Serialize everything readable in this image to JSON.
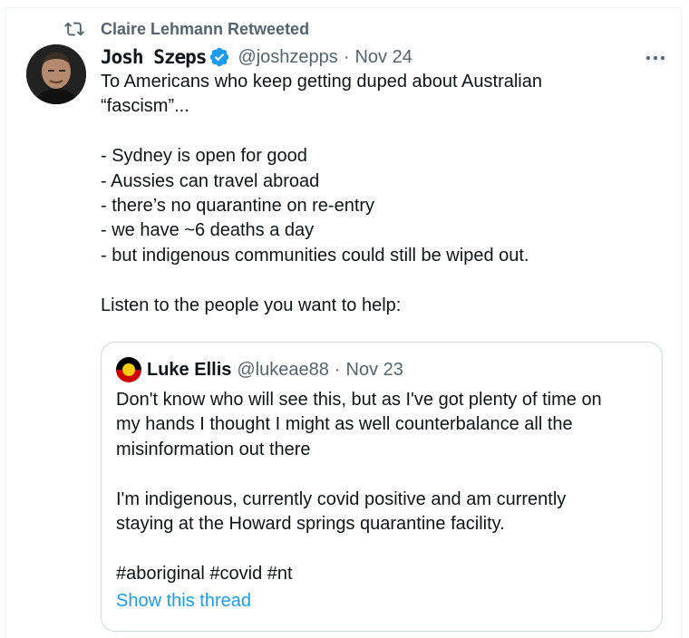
{
  "retweet": {
    "label": "Claire Lehmann Retweeted",
    "icon": "retweet-icon"
  },
  "author": {
    "display_name": "Josh Szeps",
    "handle": "@joshzepps",
    "separator": "·",
    "date": "Nov 24",
    "verified_icon": "verified-badge-icon",
    "verified_color": "#1d9bf0"
  },
  "more_icon": "more-options-icon",
  "tweet_text": "To Americans who keep getting duped about Australian\n“fascism”...\n\n- Sydney is open for good\n- Aussies can travel abroad\n- there’s no quarantine on re-entry\n- we have ~6 deaths a day\n- but indigenous communities could still be wiped out.\n\nListen to the people you want to help:",
  "quoted": {
    "display_name": "Luke Ellis",
    "handle": "@lukeae88",
    "separator": "·",
    "date": "Nov 23",
    "text": "Don't know who will see this, but as I've got plenty of time on\nmy hands I thought I might as well counterbalance all the\nmisinformation out there\n\nI'm indigenous, currently covid positive and am currently\nstaying at the Howard springs quarantine facility.\n\n#aboriginal #covid #nt",
    "show_thread_label": "Show this thread"
  },
  "colors": {
    "text": "#0f1419",
    "secondary": "#536471",
    "link": "#1d9bf0",
    "border": "#cfd9de"
  }
}
